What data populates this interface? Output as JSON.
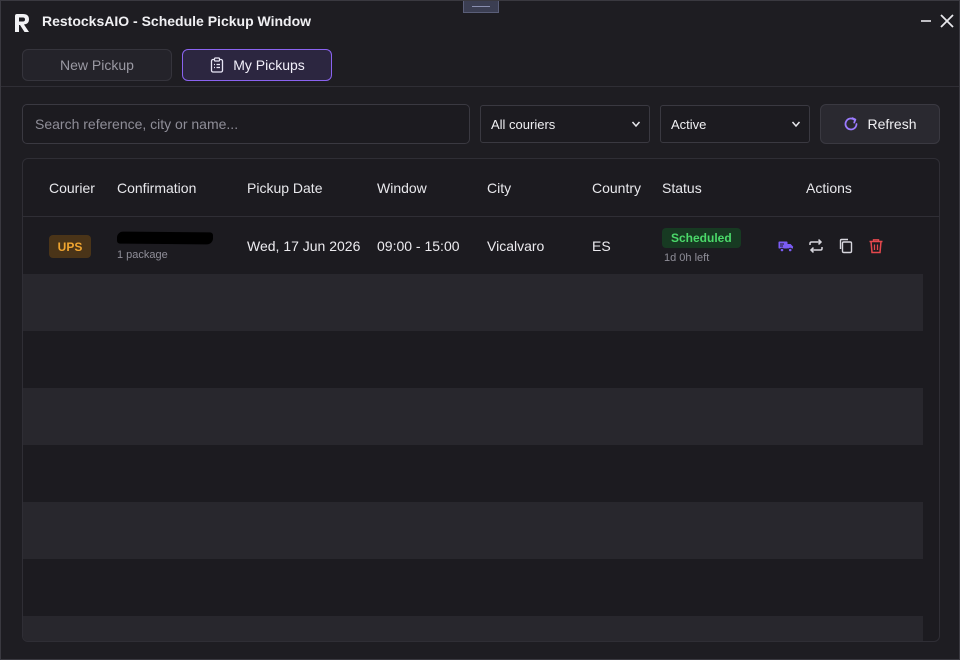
{
  "window": {
    "title": "RestocksAIO - Schedule Pickup Window"
  },
  "tabs": [
    {
      "label": "New Pickup",
      "active": false
    },
    {
      "label": "My Pickups",
      "active": true
    }
  ],
  "filters": {
    "search_placeholder": "Search reference, city or name...",
    "search_value": "",
    "courier_selected": "All couriers",
    "status_selected": "Active",
    "refresh_label": "Refresh"
  },
  "table": {
    "columns": [
      "Courier",
      "Confirmation",
      "Pickup Date",
      "Window",
      "City",
      "Country",
      "Status",
      "Actions"
    ],
    "rows": [
      {
        "courier": "UPS",
        "confirmation_sub": "1 package",
        "pickup_date": "Wed, 17 Jun 2026",
        "window": "09:00 - 15:00",
        "city": "Vicalvaro",
        "country": "ES",
        "status": "Scheduled",
        "status_sub": "1d 0h left"
      }
    ]
  },
  "colors": {
    "accent": "#8a63f0",
    "ups_badge_text": "#f0a530",
    "status_scheduled": "#4bd96a",
    "delete": "#e5484d"
  },
  "icons": {
    "app": "restocks-r-logo",
    "tab_my": "clipboard-list-icon",
    "refresh": "refresh-icon",
    "actions": [
      "truck-icon",
      "repeat-icon",
      "copy-icon",
      "trash-icon"
    ]
  }
}
